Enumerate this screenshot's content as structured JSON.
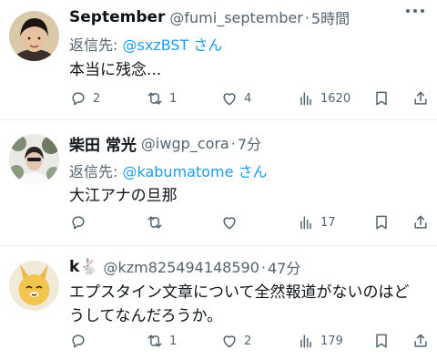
{
  "tweets": [
    {
      "display_name": "September",
      "handle": "@fumi_september",
      "separator": "·",
      "time": "5時間",
      "reply_prefix": "返信先: ",
      "reply_mention": "@sxzBST",
      "reply_suffix": " さん",
      "text": "本当に残念...",
      "counts": {
        "reply": "2",
        "retweet": "1",
        "like": "4",
        "views": "1620"
      }
    },
    {
      "display_name": "柴田 常光",
      "handle": "@iwgp_cora",
      "separator": "·",
      "time": "7分",
      "reply_prefix": "返信先: ",
      "reply_mention": "@kabumatome",
      "reply_suffix": " さん",
      "text": "大江アナの旦那",
      "counts": {
        "reply": "",
        "retweet": "",
        "like": "",
        "views": "17"
      }
    },
    {
      "display_name": "k🐇",
      "handle": "@kzm825494148590",
      "separator": "·",
      "time": "47分",
      "text_line1": "エプスタイン文章について全然報道がないのはど",
      "text_line2": "うしてなんだろうか。",
      "counts": {
        "reply": "",
        "retweet": "1",
        "like": "2",
        "views": "179"
      }
    }
  ],
  "icons": {
    "reply": "reply-bubble-icon",
    "retweet": "retweet-icon",
    "like": "heart-icon",
    "views": "views-bar-icon",
    "bookmark": "bookmark-icon",
    "share": "share-icon",
    "more": "more-dots-icon"
  },
  "colors": {
    "mention": "#1d9bf0",
    "secondary": "#536471",
    "text": "#0f1419"
  }
}
